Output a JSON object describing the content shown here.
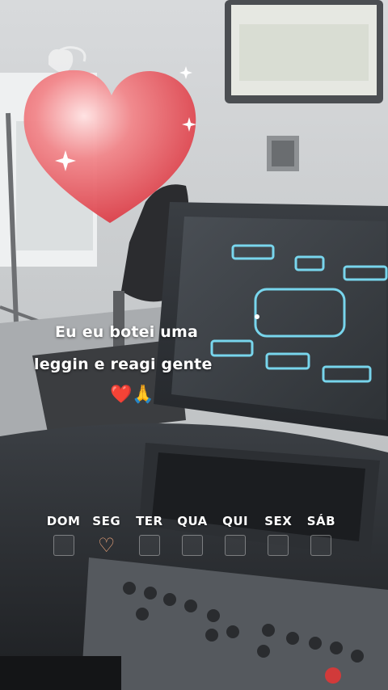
{
  "story": {
    "caption_line1": "Eu eu botei uma",
    "caption_line2": "leggin e reagi gente",
    "caption_emojis": "❤️🙏"
  },
  "sticker": {
    "icon": "heart-icon",
    "color": "#e24c56"
  },
  "week_tracker": {
    "days": [
      {
        "label": "DOM",
        "checked": false
      },
      {
        "label": "SEG",
        "checked": true
      },
      {
        "label": "TER",
        "checked": false
      },
      {
        "label": "QUA",
        "checked": false
      },
      {
        "label": "QUI",
        "checked": false
      },
      {
        "label": "SEX",
        "checked": false
      },
      {
        "label": "SÁB",
        "checked": false
      }
    ],
    "checked_symbol": "♡"
  }
}
